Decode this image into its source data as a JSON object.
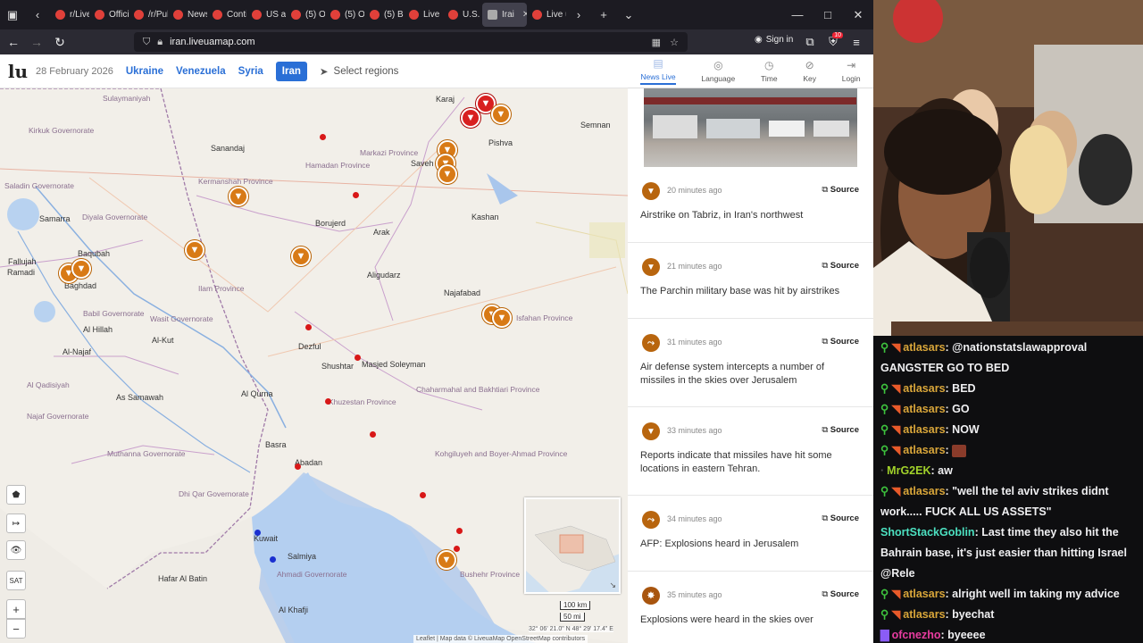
{
  "browser": {
    "tabs": [
      {
        "label": "r/Live",
        "active": false
      },
      {
        "label": "Offici",
        "active": false
      },
      {
        "label": "/r/Pul",
        "active": false
      },
      {
        "label": "News",
        "active": false
      },
      {
        "label": "Conti",
        "active": false
      },
      {
        "label": "US an",
        "active": false
      },
      {
        "label": "(5) O5",
        "active": false
      },
      {
        "label": "(5) O5",
        "active": false
      },
      {
        "label": "(5) Be",
        "active": false
      },
      {
        "label": "Live I",
        "active": false
      },
      {
        "label": "U.S. a",
        "active": false
      },
      {
        "label": "Irai",
        "active": true
      },
      {
        "label": "Live u",
        "active": false
      }
    ],
    "url": "iran.liveuamap.com",
    "signin_label": "Sign in",
    "ext_badge": "10"
  },
  "site": {
    "logo": "lu",
    "date": "28 February 2026",
    "regions": [
      "Ukraine",
      "Venezuela",
      "Syria",
      "Iran"
    ],
    "active_region": "Iran",
    "select_regions": "Select regions"
  },
  "map": {
    "labels": [
      {
        "text": "Sulaymaniyah",
        "cls": "",
        "k": "l1"
      },
      {
        "text": "Kirkuk Governorate",
        "cls": "",
        "k": "l2"
      },
      {
        "text": "Saladin Governorate",
        "cls": "",
        "k": "l3"
      },
      {
        "text": "Sanandaj",
        "cls": "city",
        "k": "l4"
      },
      {
        "text": "Kermanshah Province",
        "cls": "",
        "k": "l5"
      },
      {
        "text": "Hamadan Province",
        "cls": "",
        "k": "l6"
      },
      {
        "text": "Markazi Province",
        "cls": "",
        "k": "l7"
      },
      {
        "text": "Diyala Governorate",
        "cls": "",
        "k": "l8"
      },
      {
        "text": "Samarra",
        "cls": "city",
        "k": "l9"
      },
      {
        "text": "Baqubah",
        "cls": "city",
        "k": "l10"
      },
      {
        "text": "Fallujah",
        "cls": "city",
        "k": "l11"
      },
      {
        "text": "Ramadi",
        "cls": "city",
        "k": "l12"
      },
      {
        "text": "Baghdad",
        "cls": "city",
        "k": "l13"
      },
      {
        "text": "Ilam Province",
        "cls": "",
        "k": "l14"
      },
      {
        "text": "Borujerd",
        "cls": "city",
        "k": "l15"
      },
      {
        "text": "Arak",
        "cls": "city",
        "k": "l16"
      },
      {
        "text": "Aligudarz",
        "cls": "city",
        "k": "l17"
      },
      {
        "text": "Karaj",
        "cls": "city",
        "k": "l18"
      },
      {
        "text": "Saveh",
        "cls": "city",
        "k": "l19"
      },
      {
        "text": "Pishva",
        "cls": "city",
        "k": "l20"
      },
      {
        "text": "Semnan",
        "cls": "city",
        "k": "l21"
      },
      {
        "text": "Kashan",
        "cls": "city",
        "k": "l22"
      },
      {
        "text": "Najafabad",
        "cls": "city",
        "k": "l23"
      },
      {
        "text": "Isfahan Province",
        "cls": "",
        "k": "l24"
      },
      {
        "text": "Al Hillah",
        "cls": "city",
        "k": "l25"
      },
      {
        "text": "Al-Kut",
        "cls": "city",
        "k": "l26"
      },
      {
        "text": "Babil Governorate",
        "cls": "",
        "k": "l27"
      },
      {
        "text": "Wasit Governorate",
        "cls": "",
        "k": "l28"
      },
      {
        "text": "Al-Najaf",
        "cls": "city",
        "k": "l29"
      },
      {
        "text": "Al Qadisiyah",
        "cls": "",
        "k": "l30"
      },
      {
        "text": "As Samawah",
        "cls": "city",
        "k": "l31"
      },
      {
        "text": "Najaf Governorate",
        "cls": "",
        "k": "l32"
      },
      {
        "text": "Dezful",
        "cls": "city",
        "k": "l33"
      },
      {
        "text": "Shushtar",
        "cls": "city",
        "k": "l34"
      },
      {
        "text": "Masjed Soleyman",
        "cls": "city",
        "k": "l35"
      },
      {
        "text": "Khuzestan Province",
        "cls": "",
        "k": "l36"
      },
      {
        "text": "Chaharmahal and Bakhtiari Province",
        "cls": "",
        "k": "l37"
      },
      {
        "text": "Al Qurna",
        "cls": "city",
        "k": "l38"
      },
      {
        "text": "Kohgiluyeh and Boyer-Ahmad Province",
        "cls": "",
        "k": "l39"
      },
      {
        "text": "Basra",
        "cls": "city",
        "k": "l40"
      },
      {
        "text": "Abadan",
        "cls": "city",
        "k": "l41"
      },
      {
        "text": "Muthanna Governorate",
        "cls": "",
        "k": "l42"
      },
      {
        "text": "Kuwait",
        "cls": "city",
        "k": "l43"
      },
      {
        "text": "Salmiya",
        "cls": "city",
        "k": "l44"
      },
      {
        "text": "Ahmadi Governorate",
        "cls": "",
        "k": "l45"
      },
      {
        "text": "Hafar Al Batin",
        "cls": "city",
        "k": "l46"
      },
      {
        "text": "Al Khafji",
        "cls": "city",
        "k": "l47"
      },
      {
        "text": "Bushehr Province",
        "cls": "",
        "k": "l48"
      },
      {
        "text": "Dhi Qar Governorate",
        "cls": "",
        "k": "l49"
      }
    ],
    "controls": [
      "⬟",
      "↦",
      "👁",
      "SAT",
      "+",
      "−"
    ],
    "scale_km": "100 km",
    "scale_mi": "50 mi",
    "coords": "32° 06' 21.0\" N 48° 29' 17.4\" E",
    "attribution": "Leaflet | Map data © LiveuaMap OpenStreetMap contributors"
  },
  "panel": {
    "tabs": [
      {
        "label": "News Live",
        "icon": "news-icon",
        "glyph": "▤"
      },
      {
        "label": "Language",
        "icon": "globe-icon",
        "glyph": "◎"
      },
      {
        "label": "Time",
        "icon": "clock-icon",
        "glyph": "◷"
      },
      {
        "label": "Key",
        "icon": "compass-icon",
        "glyph": "⊘"
      },
      {
        "label": "Login",
        "icon": "login-icon",
        "glyph": "⇥"
      }
    ],
    "source_label": "Source",
    "news": [
      {
        "time": "20 minutes ago",
        "text": "Airstrike on Tabriz, in Iran's northwest",
        "icon": "missile"
      },
      {
        "time": "21 minutes ago",
        "text": "The Parchin military base was hit by airstrikes",
        "icon": "missile"
      },
      {
        "time": "31 minutes ago",
        "text": "Air defense system intercepts a number of missiles in the skies over Jerusalem",
        "icon": "aa"
      },
      {
        "time": "33 minutes ago",
        "text": "Reports indicate that missiles have hit some locations in eastern Tehran.",
        "icon": "missile"
      },
      {
        "time": "34 minutes ago",
        "text": "AFP: Explosions heard in Jerusalem",
        "icon": "aa"
      },
      {
        "time": "35 minutes ago",
        "text": "Explosions were heard in the skies over",
        "icon": "explosion"
      }
    ]
  },
  "chat": {
    "messages": [
      {
        "user": "atlasars",
        "text": ": @nationstatslawapproval GANGSTER GO TO BED",
        "ucls": ""
      },
      {
        "user": "atlasars",
        "text": ": BED",
        "ucls": ""
      },
      {
        "user": "atlasars",
        "text": ": GO",
        "ucls": ""
      },
      {
        "user": "atlasars",
        "text": ": NOW",
        "ucls": ""
      },
      {
        "user": "atlasars",
        "text": ":",
        "ucls": "",
        "emote": true
      },
      {
        "user": "MrG2EK",
        "text": ": aw",
        "ucls": "u2"
      },
      {
        "user": "atlasars",
        "text": ": \"well the tel aviv strikes didnt work..... FUCK ALL US ASSETS\"",
        "ucls": ""
      },
      {
        "user": "ShortStackGoblin",
        "text": ": Last time they also hit the Bahrain base, it's just easier than hitting Israel @Rele",
        "ucls": "u3"
      },
      {
        "user": "atlasars",
        "text": ": alright well im taking my advice",
        "ucls": ""
      },
      {
        "user": "atlasars",
        "text": ": byechat",
        "ucls": ""
      },
      {
        "user": "ofcnezho",
        "text": ": byeeee",
        "ucls": "u4"
      }
    ]
  }
}
